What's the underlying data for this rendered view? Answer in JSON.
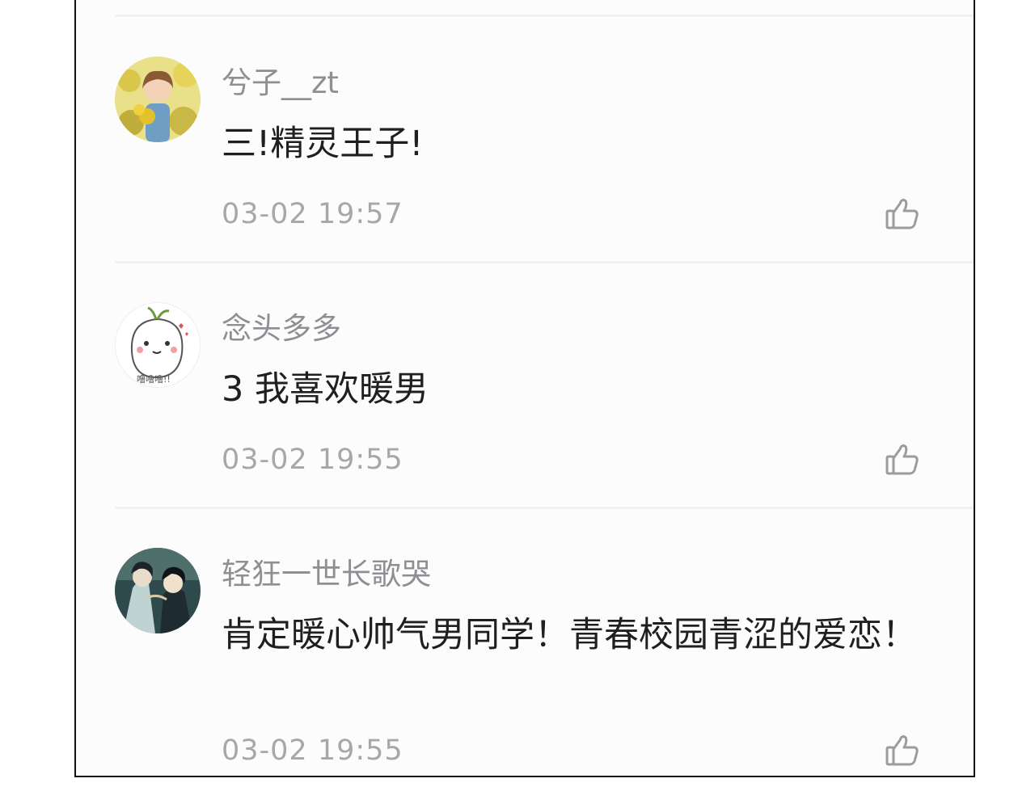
{
  "comments": [
    {
      "username": "兮子__zt",
      "content": "三!精灵王子!",
      "time": "03-02 19:57",
      "avatar_icon": "avatar-girl-flowers"
    },
    {
      "username": "念头多多",
      "content": "3 我喜欢暖男",
      "time": "03-02 19:55",
      "avatar_icon": "avatar-cartoon-bun"
    },
    {
      "username": "轻狂一世长歌哭",
      "content": "肯定暖心帅气男同学！青春校园青涩的爱恋！",
      "time": "03-02 19:55",
      "avatar_icon": "avatar-anime-pair"
    }
  ],
  "colors": {
    "username": "#8e8e93",
    "content": "#1f1f1f",
    "time": "#a7a7ab",
    "icon": "#9c9ca0"
  }
}
